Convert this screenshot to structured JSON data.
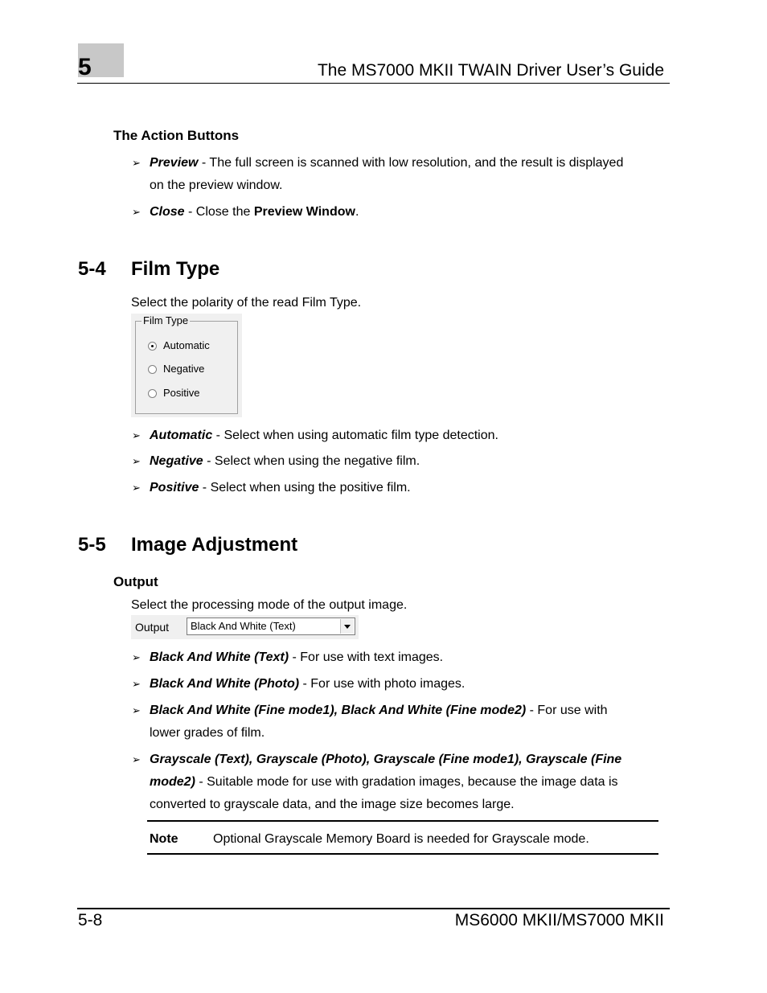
{
  "header": {
    "chapter_number": "5",
    "title": "The MS7000 MKII TWAIN Driver User’s Guide"
  },
  "action_buttons": {
    "heading": "The Action Buttons",
    "items": [
      {
        "term": "Preview",
        "desc_line1": " - The full screen is scanned with low resolution, and the result is displayed",
        "desc_line2": "on the preview window."
      },
      {
        "term": "Close",
        "desc_pre": " - Close the ",
        "bold": "Preview Window",
        "desc_post": "."
      }
    ]
  },
  "section_film": {
    "number": "5-4",
    "title": "Film Type",
    "intro": "Select the polarity of the read Film Type.",
    "widget": {
      "legend": "Film Type",
      "options": [
        "Automatic",
        "Negative",
        "Positive"
      ],
      "selected": "Automatic"
    },
    "items": [
      {
        "term": "Automatic",
        "desc": " - Select when using automatic film type detection."
      },
      {
        "term": "Negative",
        "desc": " - Select when using the negative film."
      },
      {
        "term": "Positive",
        "desc": " - Select when using the positive film."
      }
    ]
  },
  "section_image": {
    "number": "5-5",
    "title": "Image Adjustment",
    "subheading": "Output",
    "intro": "Select the processing mode of the output image.",
    "widget": {
      "label": "Output",
      "selected_value": "Black And White (Text)"
    },
    "items": [
      {
        "term": "Black And White (Text)",
        "desc": " - For use with text images."
      },
      {
        "term": "Black And White (Photo)",
        "desc": " - For use with photo images."
      },
      {
        "term": "Black And White (Fine mode1), Black And White (Fine mode2)",
        "desc": " - For use with",
        "line2": "lower grades of film."
      },
      {
        "term": "Grayscale (Text), Grayscale (Photo), Grayscale (Fine mode1), Grayscale (Fine",
        "term2": "mode2)",
        "desc": " - Suitable mode for use with gradation images, because the image data is",
        "line3": "converted to grayscale data, and the image size becomes large."
      }
    ],
    "note": {
      "label": "Note",
      "text": "Optional Grayscale Memory Board is needed for Grayscale mode."
    }
  },
  "footer": {
    "page": "5-8",
    "model": "MS6000 MKII/MS7000 MKII"
  }
}
